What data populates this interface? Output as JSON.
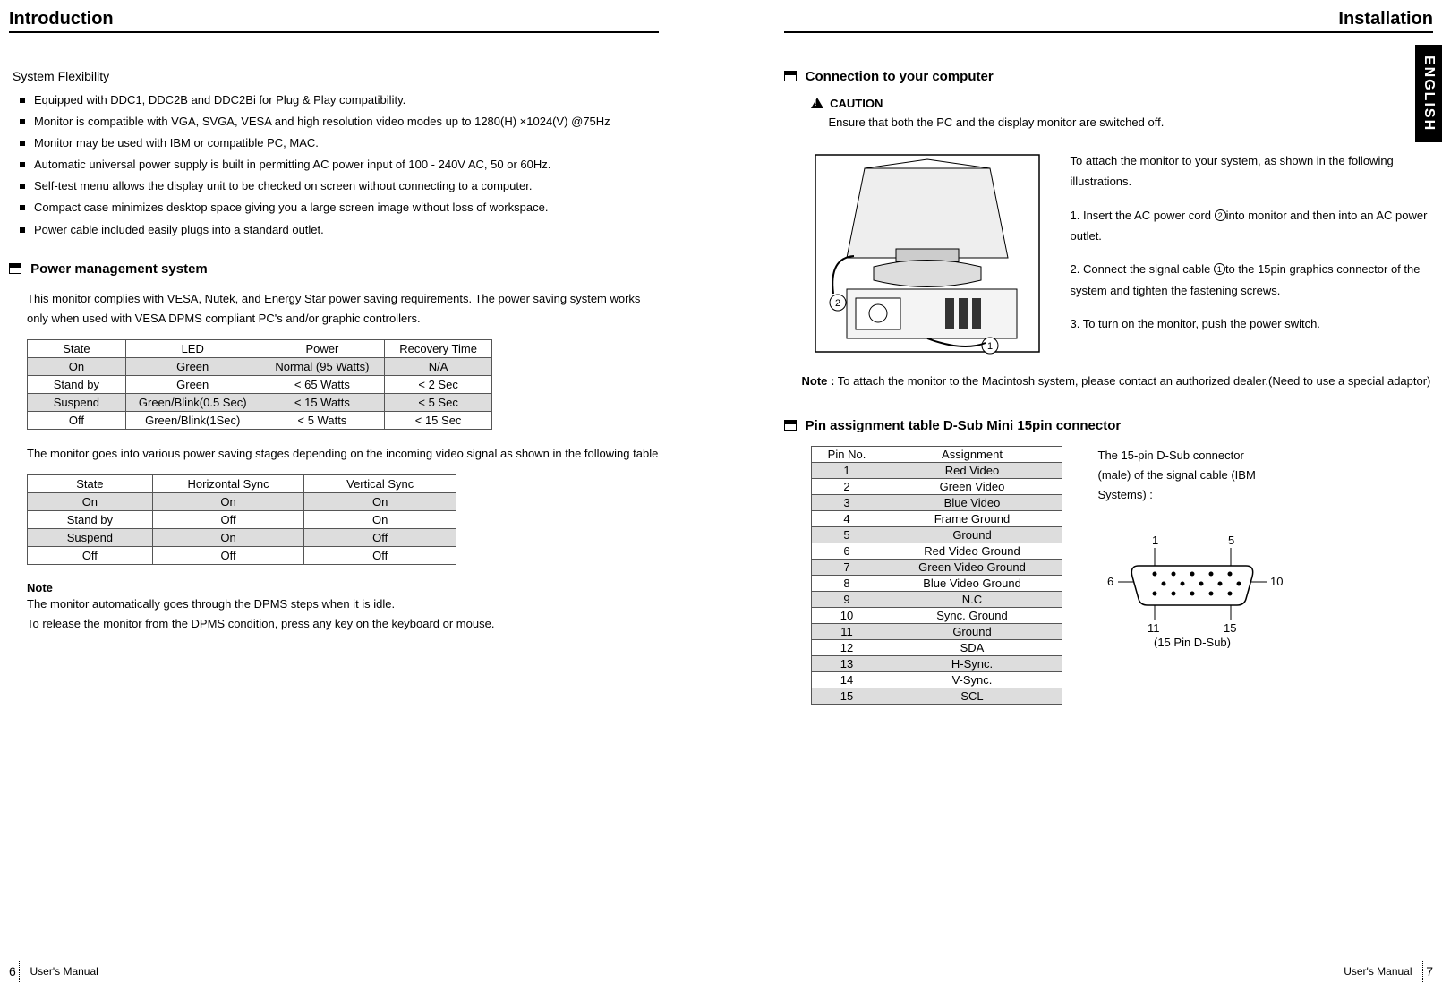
{
  "leftHeader": "Introduction",
  "rightHeader": "Installation",
  "englishTab": "ENGLISH",
  "sysFlex": {
    "title": "System Flexibility",
    "items": [
      "Equipped with DDC1, DDC2B and DDC2Bi for Plug & Play compatibility.",
      "Monitor is compatible with VGA, SVGA, VESA and high resolution video modes up to 1280(H) ×1024(V) @75Hz",
      "Monitor may be used with IBM or compatible PC, MAC.",
      "Automatic universal power supply is built in permitting AC power input of 100 - 240V AC, 50 or 60Hz.",
      "Self-test menu allows the display unit to be checked on screen without connecting to a computer.",
      "Compact case minimizes desktop space giving you a large screen image without loss of workspace.",
      "Power cable included easily plugs into a standard outlet."
    ]
  },
  "pm": {
    "title": "Power management system",
    "desc": "This monitor complies with VESA, Nutek, and Energy Star power saving requirements. The power saving system works only when used with VESA DPMS compliant PC's and/or graphic controllers.",
    "table1": {
      "headers": [
        "State",
        "LED",
        "Power",
        "Recovery Time"
      ],
      "rows": [
        {
          "shade": true,
          "cells": [
            "On",
            "Green",
            "Normal (95 Watts)",
            "N/A"
          ]
        },
        {
          "shade": false,
          "cells": [
            "Stand by",
            "Green",
            "< 65 Watts",
            "< 2 Sec"
          ]
        },
        {
          "shade": true,
          "cells": [
            "Suspend",
            "Green/Blink(0.5 Sec)",
            "< 15 Watts",
            "< 5 Sec"
          ]
        },
        {
          "shade": false,
          "cells": [
            "Off",
            "Green/Blink(1Sec)",
            "< 5 Watts",
            "< 15 Sec"
          ]
        }
      ]
    },
    "between": "The monitor goes into various power saving stages depending on the incoming video signal as shown in the following table",
    "table2": {
      "headers": [
        "State",
        "Horizontal Sync",
        "Vertical Sync"
      ],
      "rows": [
        {
          "shade": true,
          "cells": [
            "On",
            "On",
            "On"
          ]
        },
        {
          "shade": false,
          "cells": [
            "Stand by",
            "Off",
            "On"
          ]
        },
        {
          "shade": true,
          "cells": [
            "Suspend",
            "On",
            "Off"
          ]
        },
        {
          "shade": false,
          "cells": [
            "Off",
            "Off",
            "Off"
          ]
        }
      ]
    },
    "noteTitle": "Note",
    "noteBody1": "The monitor automatically goes through the DPMS steps when it is idle.",
    "noteBody2": "To release the monitor from the DPMS condition, press any key on the keyboard or mouse."
  },
  "conn": {
    "title": "Connection to your computer",
    "cautionLabel": "CAUTION",
    "cautionText": "Ensure that both the PC and the display monitor are switched off.",
    "intro": "To attach the monitor to your system, as shown in the following illustrations.",
    "step1a": "1. Insert the AC power cord ",
    "step1b": "into monitor and then into an AC power outlet.",
    "step2a": "2. Connect the signal cable ",
    "step2b": "to the 15pin graphics connector of the system and tighten the fastening screws.",
    "step3": "3. To turn on the monitor, push the power switch.",
    "noteLabel": "Note :",
    "noteText": " To attach the monitor to the Macintosh system, please contact an authorized dealer.(Need to use a special adaptor)"
  },
  "pin": {
    "title": "Pin assignment table D-Sub Mini 15pin connector",
    "headers": [
      "Pin No.",
      "Assignment"
    ],
    "rows": [
      {
        "shade": true,
        "cells": [
          "1",
          "Red Video"
        ]
      },
      {
        "shade": false,
        "cells": [
          "2",
          "Green Video"
        ]
      },
      {
        "shade": true,
        "cells": [
          "3",
          "Blue Video"
        ]
      },
      {
        "shade": false,
        "cells": [
          "4",
          "Frame Ground"
        ]
      },
      {
        "shade": true,
        "cells": [
          "5",
          "Ground"
        ]
      },
      {
        "shade": false,
        "cells": [
          "6",
          "Red Video Ground"
        ]
      },
      {
        "shade": true,
        "cells": [
          "7",
          "Green Video Ground"
        ]
      },
      {
        "shade": false,
        "cells": [
          "8",
          "Blue Video Ground"
        ]
      },
      {
        "shade": true,
        "cells": [
          "9",
          "N.C"
        ]
      },
      {
        "shade": false,
        "cells": [
          "10",
          "Sync. Ground"
        ]
      },
      {
        "shade": true,
        "cells": [
          "11",
          "Ground"
        ]
      },
      {
        "shade": false,
        "cells": [
          "12",
          "SDA"
        ]
      },
      {
        "shade": true,
        "cells": [
          "13",
          "H-Sync."
        ]
      },
      {
        "shade": false,
        "cells": [
          "14",
          "V-Sync."
        ]
      },
      {
        "shade": true,
        "cells": [
          "15",
          "SCL"
        ]
      }
    ],
    "connText": "The 15-pin D-Sub connector (male) of the signal cable (IBM Systems) :",
    "dsubLabels": {
      "p1": "1",
      "p5": "5",
      "p6": "6",
      "p10": "10",
      "p11": "11",
      "p15": "15",
      "caption": "(15 Pin D-Sub)"
    }
  },
  "footer": {
    "label": "User's Manual",
    "leftNum": "6",
    "rightNum": "7"
  }
}
